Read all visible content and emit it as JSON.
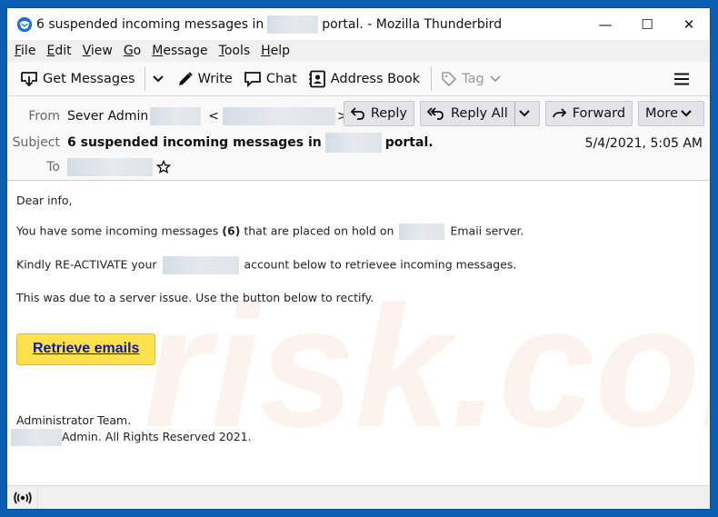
{
  "window": {
    "title_prefix": "6 suspended incoming messages in",
    "title_suffix": "portal. - Mozilla Thunderbird",
    "controls": {
      "minimize": "—",
      "maximize": "☐",
      "close": "✕"
    }
  },
  "menubar": {
    "items": [
      {
        "key": "F",
        "rest": "ile"
      },
      {
        "key": "E",
        "rest": "dit"
      },
      {
        "key": "V",
        "rest": "iew"
      },
      {
        "key": "G",
        "rest": "o"
      },
      {
        "key": "M",
        "rest": "essage"
      },
      {
        "key": "T",
        "rest": "ools"
      },
      {
        "key": "H",
        "rest": "elp"
      }
    ]
  },
  "toolbar": {
    "get_messages": "Get Messages",
    "write": "Write",
    "chat": "Chat",
    "address_book": "Address Book",
    "tag": "Tag",
    "menu_icon": "≡"
  },
  "header": {
    "from_label": "From",
    "from_name": "Sever Admin",
    "from_lt": "<",
    "from_gt": ">",
    "subject_label": "Subject",
    "subject_prefix": "6 suspended incoming messages in",
    "subject_suffix": "portal.",
    "to_label": "To",
    "date": "5/4/2021, 5:05 AM",
    "buttons": {
      "reply": "Reply",
      "reply_all": "Reply All",
      "forward": "Forward",
      "more": "More"
    }
  },
  "message": {
    "greeting": "Dear info,",
    "line1_a": "You have some incoming messages ",
    "line1_bold": "(6)",
    "line1_b": " that are placed on hold on",
    "line1_c": "Emaii server.",
    "line2_a": "Kindly RE-ACTIVATE your",
    "line2_b": "account below to retrievee incoming messages.",
    "line3": "This was due to a server issue. Use the button below to rectify.",
    "cta": "Retrieve emails",
    "sign1": "Administrator Team.",
    "sign2": "Admin. All Rights Reserved 2021."
  },
  "colors": {
    "window_frame": "#0a5fb0",
    "cta_bg": "#fde14a",
    "cta_text": "#0b1ba0"
  }
}
